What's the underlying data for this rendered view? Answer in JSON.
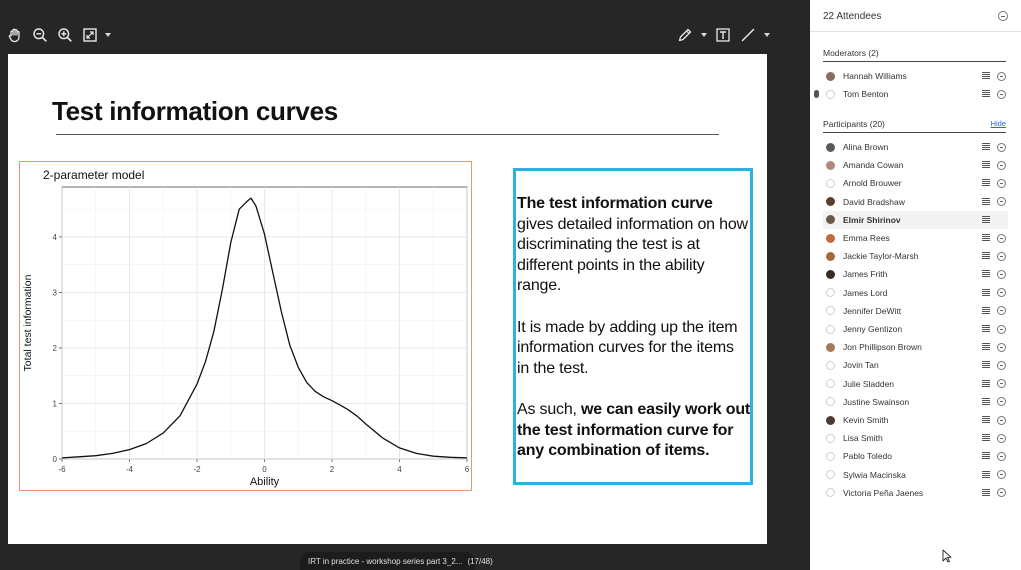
{
  "toolbar": {
    "left_tools": [
      "hand-icon",
      "zoom-out-icon",
      "zoom-in-icon",
      "fit-icon"
    ],
    "right_tools": [
      "pen-icon",
      "text-icon",
      "line-icon"
    ]
  },
  "slide": {
    "title": "Test information curves",
    "paragraphs": [
      {
        "bold": "The test information curve",
        "rest": " gives detailed information on how discriminating the test is at different points in the ability range."
      },
      {
        "bold": "",
        "rest": "It is made by adding up the item information curves for the items in the test."
      },
      {
        "pre": "As such, ",
        "bold": "we can easily work out the test information curve for any combination of items."
      }
    ]
  },
  "chart_data": {
    "type": "line",
    "title": "2-parameter model",
    "xlabel": "Ability",
    "ylabel": "Total test information",
    "xlim": [
      -6,
      6
    ],
    "ylim": [
      0,
      4.9
    ],
    "xticks": [
      -6,
      -4,
      -2,
      0,
      2,
      4,
      6
    ],
    "yticks": [
      0,
      1,
      2,
      3,
      4
    ],
    "grid": true,
    "series": [
      {
        "x": [
          -6,
          -5.5,
          -5,
          -4.5,
          -4,
          -3.5,
          -3,
          -2.5,
          -2,
          -1.75,
          -1.5,
          -1.25,
          -1,
          -0.75,
          -0.5,
          -0.4,
          -0.25,
          0,
          0.25,
          0.5,
          0.75,
          1,
          1.25,
          1.5,
          1.75,
          2,
          2.25,
          2.5,
          2.75,
          3,
          3.5,
          4,
          4.5,
          5,
          5.5,
          6
        ],
        "y": [
          0.02,
          0.04,
          0.06,
          0.1,
          0.17,
          0.28,
          0.47,
          0.78,
          1.35,
          1.75,
          2.3,
          3.05,
          3.9,
          4.5,
          4.65,
          4.7,
          4.55,
          4.05,
          3.35,
          2.65,
          2.05,
          1.65,
          1.38,
          1.22,
          1.12,
          1.05,
          0.97,
          0.88,
          0.77,
          0.63,
          0.38,
          0.2,
          0.1,
          0.05,
          0.03,
          0.02
        ]
      }
    ]
  },
  "footer": {
    "session_title": "IRT in practice - workshop series part 3_2...",
    "slide_counter": "(17/48)"
  },
  "panel": {
    "title": "22 Attendees",
    "moderators_label": "Moderators (2)",
    "participants_label": "Participants (20)",
    "hide_label": "Hide",
    "moderators": [
      {
        "name": "Hannah Williams",
        "avatar": "#8a6a58"
      },
      {
        "name": "Tom Benton",
        "avatar": "",
        "mic": true
      }
    ],
    "participants": [
      {
        "name": "Alina Brown",
        "avatar": "#5a5a5a"
      },
      {
        "name": "Amanda Cowan",
        "avatar": "#b08a7a"
      },
      {
        "name": "Arnold Brouwer",
        "avatar": ""
      },
      {
        "name": "David Bradshaw",
        "avatar": "#5a3e30"
      },
      {
        "name": "Elmir Shirinov",
        "avatar": "#6a5a4a",
        "bold": true,
        "no_minus": true
      },
      {
        "name": "Emma Rees",
        "avatar": "#c06a40"
      },
      {
        "name": "Jackie Taylor-Marsh",
        "avatar": "#a66a3a"
      },
      {
        "name": "James Frith",
        "avatar": "#3a2a20"
      },
      {
        "name": "James Lord",
        "avatar": ""
      },
      {
        "name": "Jennifer DeWitt",
        "avatar": ""
      },
      {
        "name": "Jenny Gentizon",
        "avatar": ""
      },
      {
        "name": "Jon Phillipson Brown",
        "avatar": "#a57a5a"
      },
      {
        "name": "Jovin Tan",
        "avatar": ""
      },
      {
        "name": "Julie Sladden",
        "avatar": ""
      },
      {
        "name": "Justine Swainson",
        "avatar": ""
      },
      {
        "name": "Kevin Smith",
        "avatar": "#4a3a30"
      },
      {
        "name": "Lisa Smith",
        "avatar": ""
      },
      {
        "name": "Pablo Toledo",
        "avatar": ""
      },
      {
        "name": "Sylwia Macinska",
        "avatar": ""
      },
      {
        "name": "Victoria Peña Jaenes",
        "avatar": ""
      }
    ]
  }
}
